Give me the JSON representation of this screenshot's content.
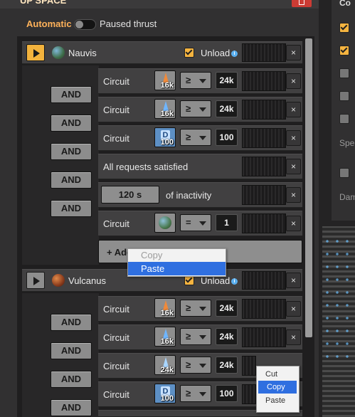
{
  "window": {
    "title": "UP SPACE"
  },
  "header": {
    "automatic_label": "Automatic",
    "paused_label": "Paused thrust"
  },
  "stops": [
    {
      "planet": "Nauvis",
      "unload_label": "Unload",
      "conditions": [
        {
          "label": "Circuit",
          "item_count": "16k",
          "comparator": "≥",
          "value": "24k"
        },
        {
          "label": "Circuit",
          "item_count": "16k",
          "comparator": "≥",
          "value": "24k"
        },
        {
          "label": "Circuit",
          "item_count": "100",
          "comparator": "≥",
          "value": "100"
        },
        {
          "label": "All requests satisfied"
        },
        {
          "label": "of inactivity",
          "duration": "120 s"
        },
        {
          "label": "Circuit",
          "comparator": "=",
          "value": "1"
        }
      ],
      "and_label": "AND",
      "add_label": "+ Add"
    },
    {
      "planet": "Vulcanus",
      "unload_label": "Unload",
      "conditions": [
        {
          "label": "Circuit",
          "item_count": "16k",
          "comparator": "≥",
          "value": "24k"
        },
        {
          "label": "Circuit",
          "item_count": "16k",
          "comparator": "≥",
          "value": "24k"
        },
        {
          "label": "Circuit",
          "item_count": "24k",
          "comparator": "≥",
          "value": "24k"
        },
        {
          "label": "Circuit",
          "item_count": "100",
          "comparator": "≥",
          "value": "100"
        }
      ],
      "and_label": "AND"
    }
  ],
  "context_menu_1": {
    "items": [
      "Copy",
      "Paste"
    ]
  },
  "context_menu_2": {
    "items": [
      "Cut",
      "Copy",
      "Paste"
    ]
  },
  "right_panel": {
    "title_fragment": "Co",
    "labels": [
      "Spe",
      "Dam"
    ]
  },
  "colors": {
    "accent": "#f3b33d",
    "panel": "#313031",
    "selection": "#2f6fe0"
  }
}
